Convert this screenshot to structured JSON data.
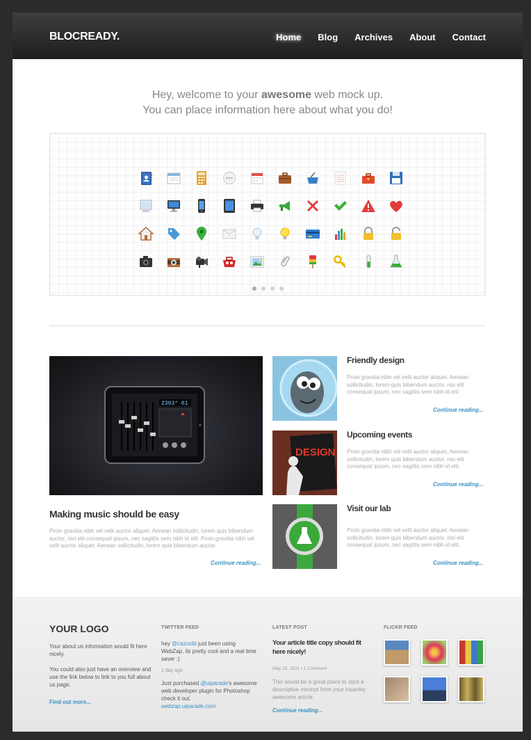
{
  "header": {
    "logo": "BLOCREADY.",
    "nav": [
      {
        "label": "Home",
        "active": true
      },
      {
        "label": "Blog"
      },
      {
        "label": "Archives"
      },
      {
        "label": "About"
      },
      {
        "label": "Contact"
      }
    ]
  },
  "welcome": {
    "line1_prefix": "Hey, welcome to your ",
    "line1_bold": "awesome",
    "line1_suffix": " web mock up.",
    "line2": "You can place information here about what you do!"
  },
  "showcase": {
    "icons": [
      "address-book-icon",
      "calendar-window-icon",
      "calculator-icon",
      "chat-bubble-icon",
      "calendar-icon",
      "briefcase-icon",
      "basket-icon",
      "notepad-icon",
      "toolbox-icon",
      "floppy-disk-icon",
      "monitor-old-icon",
      "monitor-icon",
      "phone-icon",
      "tablet-icon",
      "printer-icon",
      "megaphone-icon",
      "cross-icon",
      "check-icon",
      "warning-icon",
      "heart-icon",
      "home-icon",
      "tag-icon",
      "map-pin-icon",
      "envelope-icon",
      "bulb-off-icon",
      "bulb-on-icon",
      "credit-card-icon",
      "bar-chart-icon",
      "lock-closed-icon",
      "lock-open-icon",
      "camera-icon",
      "camera-retro-icon",
      "video-camera-icon",
      "toolbox-red-icon",
      "picture-icon",
      "paperclip-icon",
      "ice-cream-icon",
      "key-icon",
      "test-tube-icon",
      "flask-icon"
    ],
    "active_slide": 1,
    "slides": 4
  },
  "feature": {
    "title": "Making music should be easy",
    "text": "Proin gravida nibh vel velit auctor aliquet. Aenean sollicitudin, lorem quis bibendum auctor, nisi elit consequat ipsum, nec sagittis sem nibh id elit. Proin gravida nibh vel velit auctor aliquet. Aenean sollicitudin, lorem quis bibendum auctor.",
    "more": "Continue reading...",
    "display": "2303° 01"
  },
  "posts": [
    {
      "title": "Friendly design",
      "text": "Proin gravida nibh vel velit auctor aliquet. Aenean sollicitudin, lorem quis bibendum auctor, nisi elit consequat ipsum, nec sagittis sem nibh id elit.",
      "more": "Continue reading..."
    },
    {
      "title": "Upcoming events",
      "text": "Proin gravida nibh vel velit auctor aliquet. Aenean sollicitudin, lorem quis bibendum auctor, nisi elit consequat ipsum, nec sagittis sem nibh id elit.",
      "more": "Continue reading...",
      "poster_word": "DESIGN"
    },
    {
      "title": "Visit our lab",
      "text": "Proin gravida nibh vel velit auctor aliquet. Aenean sollicitudin, lorem quis bibendum auctor, nisi elit consequat ipsum, nec sagittis sem nibh id elit.",
      "more": "Continue reading..."
    }
  ],
  "footer": {
    "logo": "YOUR LOGO",
    "about1": "Your about us information would fit here nicely.",
    "about2": "You could also just have an overview and use the link below to link to you full about us page.",
    "about_link": "Find out more...",
    "twitter_head": "TWITTER FEED",
    "tweet1_a": "hey ",
    "tweet1_user": "@cazoobi",
    "tweet1_b": " just been using WebZap, its pretty cool and a real time saver :)",
    "tweet1_time": "1 day ago",
    "tweet2_a": "Just purchased ",
    "tweet2_user": "@uiparade",
    "tweet2_b": "'s awesome web developer plugin for Photoshop check it out.",
    "tweet2_link": "webzap.uiparade.com",
    "latest_head": "LATEST POST",
    "latest_title": "Your article title copy should fit here nicely!",
    "latest_meta": "May 22, 2011 • 1 Comment",
    "latest_excerpt": "This would be a great place to stick a descriptive excerpt from your insanley awesome article.",
    "latest_more": "Continue reading...",
    "flickr_head": "FLICKR FEED"
  },
  "colors": {
    "link": "#3a8fc5",
    "header_dark": "#1e1e1e",
    "page_bg": "#2b2b2b"
  }
}
